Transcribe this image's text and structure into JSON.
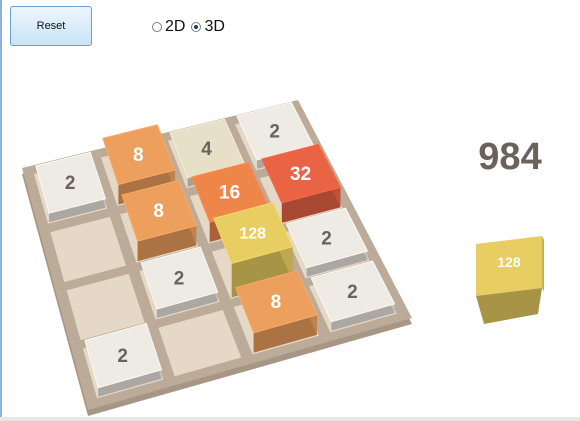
{
  "controls": {
    "reset_label": "Reset",
    "mode_2d_label": "2D",
    "mode_3d_label": "3D",
    "selected_mode": "3D"
  },
  "score": "984",
  "next_tile": {
    "value": "128",
    "color": "#e8cd62"
  },
  "board": {
    "rows": [
      [
        "2",
        "8",
        "4",
        "2"
      ],
      [
        "",
        "8",
        "16",
        "32"
      ],
      [
        "",
        "2",
        "128",
        "2"
      ],
      [
        "2",
        "",
        "8",
        "2"
      ]
    ]
  },
  "colors": {
    "board": "#bcab99",
    "empty_cell": "#e6d8c7",
    "tile_2": "#eeeae4",
    "tile_4": "#e8dfc9",
    "tile_8": "#ed9f5e",
    "tile_16": "#ee8549",
    "tile_32": "#ea6345",
    "tile_128": "#e8cd62",
    "text_dark": "#6b625a",
    "text_light": "#ffffff"
  }
}
